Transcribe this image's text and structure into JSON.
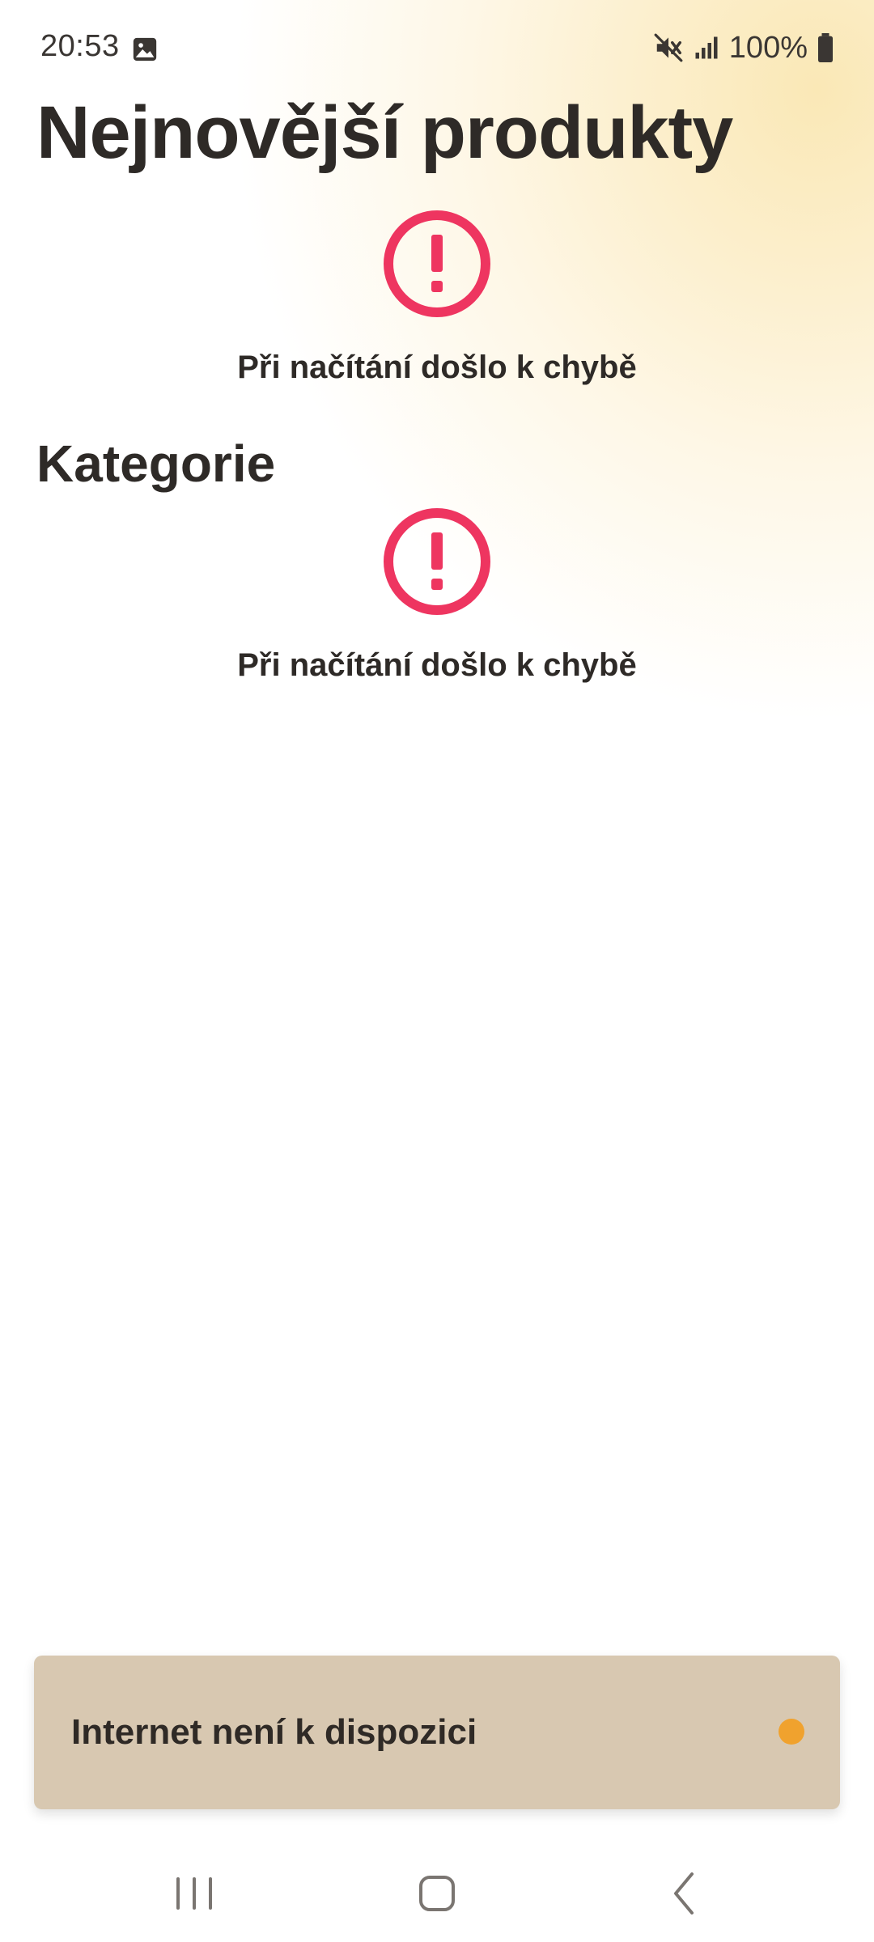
{
  "status_bar": {
    "time": "20:53",
    "battery": "100%",
    "icons": [
      "gallery-icon",
      "mute-icon",
      "signal-icon",
      "battery-icon"
    ]
  },
  "sections": {
    "products_title": "Nejnovější produkty",
    "categories_title": "Kategorie"
  },
  "errors": {
    "products_message": "Při načítání došlo k chybě",
    "categories_message": "Při načítání došlo k chybě",
    "icon": "error-exclamation-icon"
  },
  "snackbar": {
    "message": "Internet není k dispozici",
    "indicator_icon": "offline-dot-icon"
  },
  "nav_bar": {
    "icons": [
      "recents-icon",
      "home-icon",
      "back-icon"
    ]
  },
  "colors": {
    "error_accent": "#ee3560",
    "snackbar_bg": "#d8c8b1",
    "snackbar_dot": "#f0a22e",
    "text_primary": "#2e2a27",
    "glow": "#fae8b6"
  }
}
